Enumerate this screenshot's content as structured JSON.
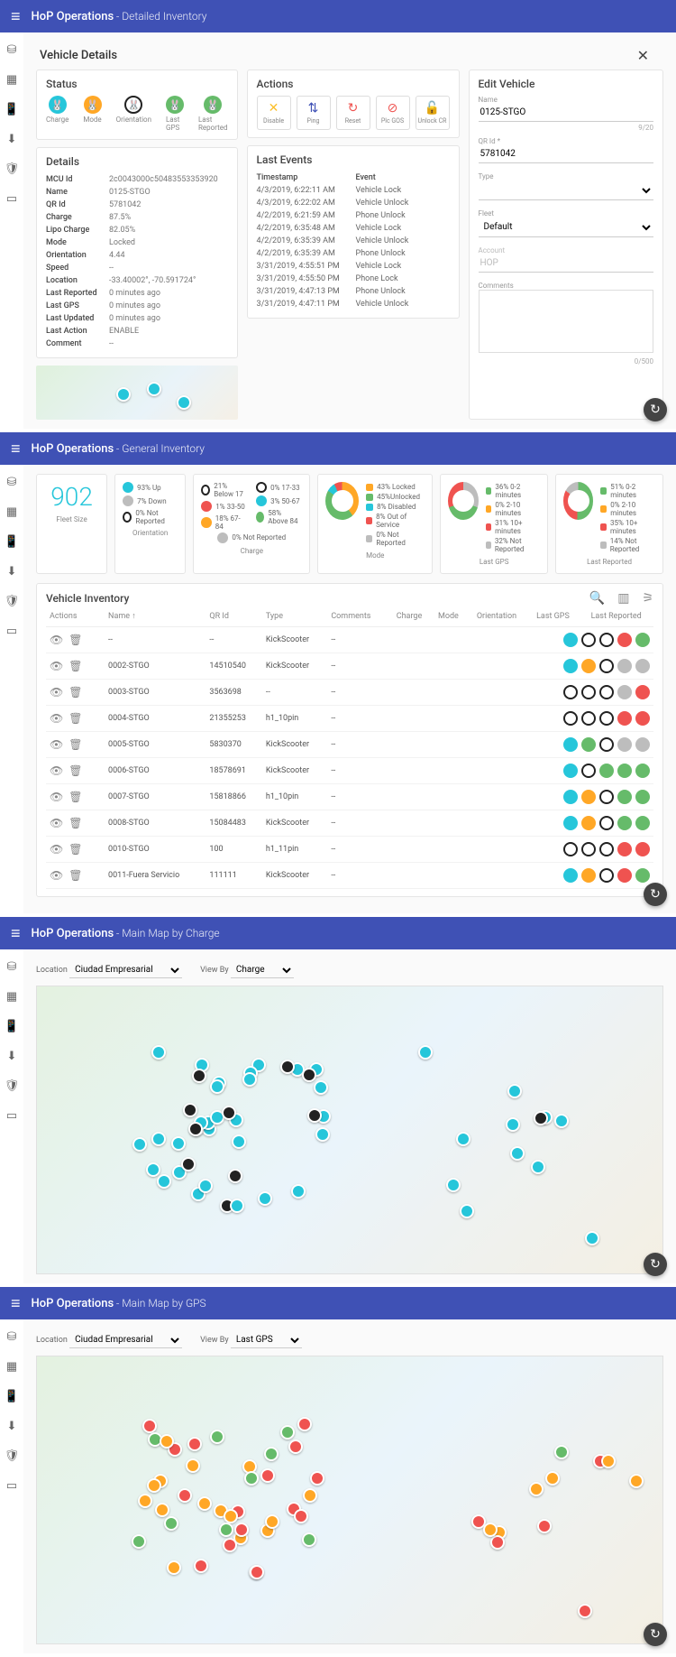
{
  "s1": {
    "title": "HoP Operations",
    "sub": "Detailed Inventory",
    "header": "Vehicle Details",
    "status": {
      "label": "Status",
      "items": [
        {
          "lbl": "Charge",
          "cls": "teal"
        },
        {
          "lbl": "Mode",
          "cls": "orange"
        },
        {
          "lbl": "Orientation",
          "cls": "black"
        },
        {
          "lbl": "Last GPS",
          "cls": "green"
        },
        {
          "lbl": "Last Reported",
          "cls": "green"
        }
      ]
    },
    "actions": {
      "label": "Actions",
      "items": [
        {
          "lbl": "Disable",
          "ic": "✕",
          "col": "#fbc02d"
        },
        {
          "lbl": "Ping",
          "ic": "⇅",
          "col": "#3f51b5"
        },
        {
          "lbl": "Reset",
          "ic": "↻",
          "col": "#ef5350"
        },
        {
          "lbl": "Plc GOS",
          "ic": "⊘",
          "col": "#ef5350"
        },
        {
          "lbl": "Unlock CR",
          "ic": "🔓",
          "col": "#66bb6a"
        }
      ]
    },
    "details": {
      "label": "Details",
      "rows": [
        [
          "MCU Id",
          "2c0043000c50483553353920"
        ],
        [
          "Name",
          "0125-STGO"
        ],
        [
          "QR Id",
          "5781042"
        ],
        [
          "Charge",
          "87.5%"
        ],
        [
          "Lipo Charge",
          "82.05%"
        ],
        [
          "Mode",
          "Locked"
        ],
        [
          "Orientation",
          "4.44"
        ],
        [
          "Speed",
          "--"
        ],
        [
          "Location",
          "-33.40002°, -70.591724°"
        ],
        [
          "Last Reported",
          "0 minutes ago"
        ],
        [
          "Last GPS",
          "0 minutes ago"
        ],
        [
          "Last Updated",
          "0 minutes ago"
        ],
        [
          "Last Action",
          "ENABLE"
        ],
        [
          "Comment",
          "--"
        ]
      ]
    },
    "events": {
      "label": "Last Events",
      "cols": [
        "Timestamp",
        "Event"
      ],
      "rows": [
        [
          "4/3/2019, 6:22:11 AM",
          "Vehicle Lock"
        ],
        [
          "4/3/2019, 6:22:02 AM",
          "Vehicle Unlock"
        ],
        [
          "4/2/2019, 6:21:59 AM",
          "Phone Unlock"
        ],
        [
          "4/2/2019, 6:35:48 AM",
          "Vehicle Lock"
        ],
        [
          "4/2/2019, 6:35:39 AM",
          "Vehicle Unlock"
        ],
        [
          "4/2/2019, 6:35:39 AM",
          "Phone Unlock"
        ],
        [
          "3/31/2019, 4:55:51 PM",
          "Vehicle Lock"
        ],
        [
          "3/31/2019, 4:55:50 PM",
          "Phone Lock"
        ],
        [
          "3/31/2019, 4:47:13 PM",
          "Phone Unlock"
        ],
        [
          "3/31/2019, 4:47:11 PM",
          "Vehicle Unlock"
        ]
      ]
    },
    "edit": {
      "label": "Edit Vehicle",
      "name_lbl": "Name",
      "name": "0125-STGO",
      "name_count": "9/20",
      "qr_lbl": "QR Id *",
      "qr": "5781042",
      "type_lbl": "Type",
      "fleet_lbl": "Fleet",
      "fleet": "Default",
      "account_lbl": "Account",
      "account": "HOP",
      "comments_lbl": "Comments",
      "comments_count": "0/500"
    }
  },
  "s2": {
    "title": "HoP Operations",
    "sub": "General Inventory",
    "fleet": {
      "value": "902",
      "lbl": "Fleet Size"
    },
    "orientation": {
      "lbl": "Orientation",
      "items": [
        {
          "d": "teal",
          "t": "93% Up"
        },
        {
          "d": "grey",
          "t": "7% Down"
        },
        {
          "d": "black",
          "t": "0% Not Reported"
        }
      ]
    },
    "charge": {
      "lbl": "Charge",
      "left": [
        {
          "d": "black",
          "t": "21% Below 17"
        },
        {
          "d": "red",
          "t": "1% 33-50"
        },
        {
          "d": "orange",
          "t": "18% 67-84"
        }
      ],
      "right": [
        {
          "d": "black",
          "t": "0% 17-33"
        },
        {
          "d": "teal",
          "t": "3% 50-67"
        },
        {
          "d": "green",
          "t": "58% Above 84"
        }
      ],
      "foot": "0% Not Reported"
    },
    "mode": {
      "lbl": "Mode",
      "items": [
        {
          "c": "orange",
          "t": "43% Locked"
        },
        {
          "c": "green",
          "t": "45%Unlocked"
        },
        {
          "c": "teal",
          "t": "8% Disabled"
        },
        {
          "c": "red",
          "t": "8% Out of Service"
        },
        {
          "c": "grey",
          "t": "0% Not Reported"
        }
      ]
    },
    "gps": {
      "lbl": "Last GPS",
      "items": [
        {
          "c": "green",
          "t": "36% 0-2 minutes"
        },
        {
          "c": "orange",
          "t": "0% 2-10 minutes"
        },
        {
          "c": "red",
          "t": "31% 10+ minutes"
        },
        {
          "c": "grey",
          "t": "32% Not Reported"
        }
      ]
    },
    "rep": {
      "lbl": "Last Reported",
      "items": [
        {
          "c": "green",
          "t": "51% 0-2 minutes"
        },
        {
          "c": "orange",
          "t": "0% 2-10 minutes"
        },
        {
          "c": "red",
          "t": "35% 10+ minutes"
        },
        {
          "c": "grey",
          "t": "14% Not Reported"
        }
      ]
    },
    "inv": {
      "label": "Vehicle Inventory",
      "cols": [
        "Actions",
        "Name ↑",
        "QR Id",
        "Type",
        "Comments",
        "Charge",
        "Mode",
        "Orientation",
        "Last GPS",
        "Last Reported"
      ],
      "rows": [
        {
          "name": "--",
          "qr": "--",
          "type": "KickScooter",
          "c": "--",
          "dots": [
            "teal",
            "black",
            "black",
            "red",
            "green"
          ]
        },
        {
          "name": "0002-STGO",
          "qr": "14510540",
          "type": "KickScooter",
          "c": "--",
          "dots": [
            "teal",
            "orange",
            "black",
            "grey",
            "grey"
          ]
        },
        {
          "name": "0003-STGO",
          "qr": "3563698",
          "type": "--",
          "c": "--",
          "dots": [
            "black",
            "black",
            "black",
            "grey",
            "red"
          ]
        },
        {
          "name": "0004-STGO",
          "qr": "21355253",
          "type": "h1_10pin",
          "c": "--",
          "dots": [
            "black",
            "black",
            "black",
            "red",
            "red"
          ]
        },
        {
          "name": "0005-STGO",
          "qr": "5830370",
          "type": "KickScooter",
          "c": "--",
          "dots": [
            "teal",
            "green",
            "black",
            "grey",
            "grey"
          ]
        },
        {
          "name": "0006-STGO",
          "qr": "18578691",
          "type": "KickScooter",
          "c": "--",
          "dots": [
            "teal",
            "black",
            "green",
            "green",
            "green"
          ]
        },
        {
          "name": "0007-STGO",
          "qr": "15818866",
          "type": "h1_10pin",
          "c": "--",
          "dots": [
            "teal",
            "orange",
            "black",
            "green",
            "green"
          ]
        },
        {
          "name": "0008-STGO",
          "qr": "15084483",
          "type": "KickScooter",
          "c": "--",
          "dots": [
            "teal",
            "orange",
            "black",
            "green",
            "green"
          ]
        },
        {
          "name": "0010-STGO",
          "qr": "100",
          "type": "h1_11pin",
          "c": "--",
          "dots": [
            "black",
            "black",
            "black",
            "red",
            "red"
          ]
        },
        {
          "name": "0011-Fuera Servicio",
          "qr": "111111",
          "type": "KickScooter",
          "c": "--",
          "dots": [
            "teal",
            "orange",
            "black",
            "red",
            "green"
          ]
        }
      ]
    }
  },
  "s3": {
    "title": "HoP Operations",
    "sub": "Main Map by Charge",
    "loc_lbl": "Location",
    "loc": "Ciudad Empresarial",
    "view_lbl": "View By",
    "view": "Charge"
  },
  "s4": {
    "title": "HoP Operations",
    "sub": "Main Map by GPS",
    "loc_lbl": "Location",
    "loc": "Ciudad Empresarial",
    "view_lbl": "View By",
    "view": "Last GPS"
  }
}
